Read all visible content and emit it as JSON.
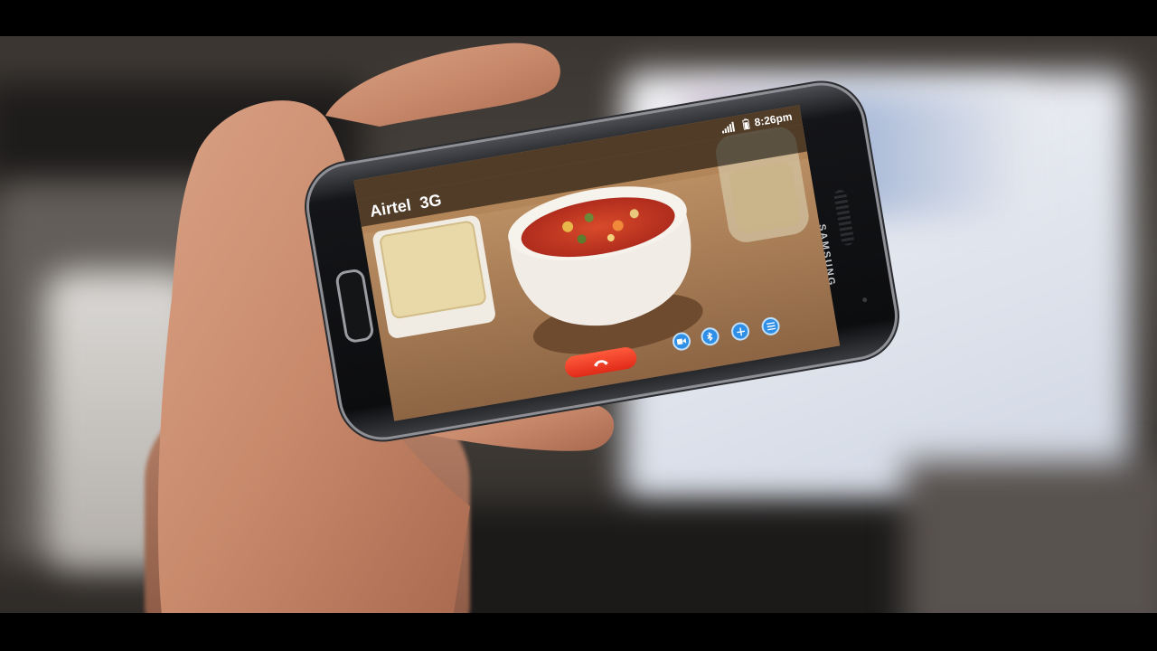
{
  "status_bar": {
    "time": "8:26pm",
    "signal_icon": "signal-icon",
    "battery_icon": "battery-icon"
  },
  "call": {
    "carrier": "Airtel",
    "network": "3G"
  },
  "controls": {
    "end_call_icon": "phone-hangup-icon",
    "buttons": [
      "video-camera-icon",
      "bluetooth-icon",
      "add-icon",
      "menu-icon"
    ],
    "end_call_color": "#f03a22",
    "button_color": "#2f8ee6"
  },
  "device": {
    "brand": "SAMSUNG"
  }
}
